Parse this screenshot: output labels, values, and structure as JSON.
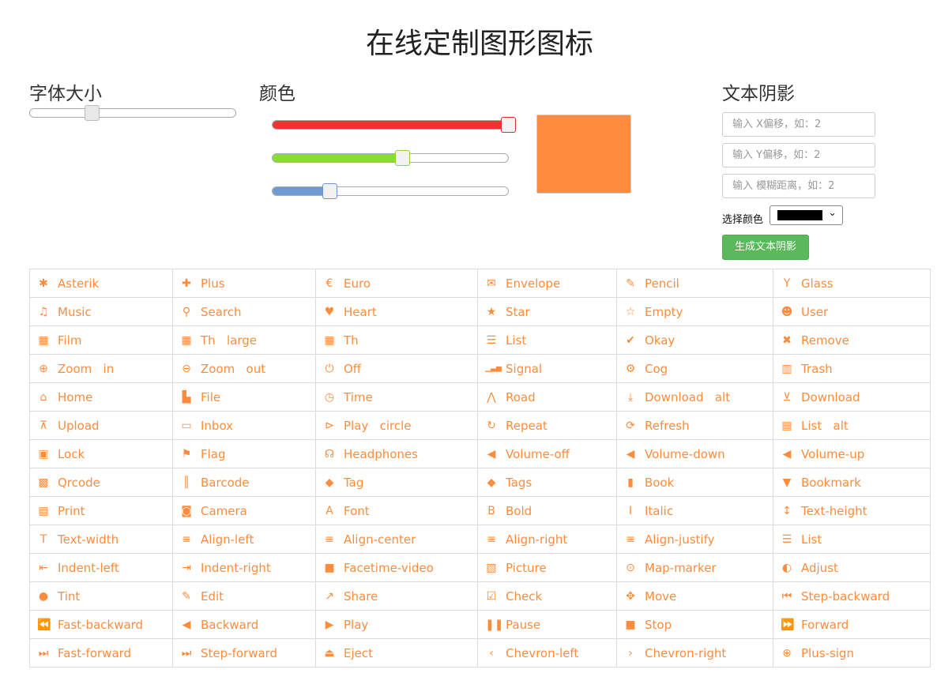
{
  "title": "在线定制图形图标",
  "font_size": {
    "label": "字体大小",
    "value": 0.3
  },
  "color": {
    "label": "颜色",
    "red": 1.0,
    "green": 0.55,
    "blue": 0.24,
    "red_fill": "#ee3333",
    "green_fill": "#88dd33",
    "blue_fill": "#6e9bd1",
    "preview_hex": "#ff8c3d"
  },
  "text_shadow": {
    "label": "文本阴影",
    "x_placeholder": "输入 X偏移，如：2",
    "y_placeholder": "输入 Y偏移，如：2",
    "blur_placeholder": "输入 模糊距离，如：2",
    "color_label": "选择颜色",
    "selected_color": "#000000",
    "button_label": "生成文本阴影",
    "button_color": "#5cb85c"
  },
  "icon_color": "#ff8c3d",
  "icons": [
    [
      {
        "name": "Asterik",
        "icon": "asterisk"
      },
      {
        "name": "Plus",
        "icon": "plus"
      },
      {
        "name": "Euro",
        "icon": "euro"
      },
      {
        "name": "Envelope",
        "icon": "envelope"
      },
      {
        "name": "Pencil",
        "icon": "pencil"
      },
      {
        "name": "Glass",
        "icon": "glass"
      }
    ],
    [
      {
        "name": "Music",
        "icon": "music"
      },
      {
        "name": "Search",
        "icon": "search"
      },
      {
        "name": "Heart",
        "icon": "heart"
      },
      {
        "name": "Star",
        "icon": "star"
      },
      {
        "name": "Empty",
        "icon": "star-empty"
      },
      {
        "name": "User",
        "icon": "user"
      }
    ],
    [
      {
        "name": "Film",
        "icon": "film"
      },
      {
        "name": "Th   large",
        "icon": "th-large"
      },
      {
        "name": "Th",
        "icon": "th"
      },
      {
        "name": "List",
        "icon": "th-list"
      },
      {
        "name": "Okay",
        "icon": "ok"
      },
      {
        "name": "Remove",
        "icon": "remove"
      }
    ],
    [
      {
        "name": "Zoom   in",
        "icon": "zoom-in"
      },
      {
        "name": "Zoom   out",
        "icon": "zoom-out"
      },
      {
        "name": "Off",
        "icon": "off"
      },
      {
        "name": "Signal",
        "icon": "signal"
      },
      {
        "name": "Cog",
        "icon": "cog"
      },
      {
        "name": "Trash",
        "icon": "trash"
      }
    ],
    [
      {
        "name": "Home",
        "icon": "home"
      },
      {
        "name": "File",
        "icon": "file"
      },
      {
        "name": "Time",
        "icon": "time"
      },
      {
        "name": "Road",
        "icon": "road"
      },
      {
        "name": "Download   alt",
        "icon": "download-alt"
      },
      {
        "name": "Download",
        "icon": "download"
      }
    ],
    [
      {
        "name": "Upload",
        "icon": "upload"
      },
      {
        "name": "Inbox",
        "icon": "inbox"
      },
      {
        "name": "Play   circle",
        "icon": "play-circle"
      },
      {
        "name": "Repeat",
        "icon": "repeat"
      },
      {
        "name": "Refresh",
        "icon": "refresh"
      },
      {
        "name": "List   alt",
        "icon": "list-alt"
      }
    ],
    [
      {
        "name": "Lock",
        "icon": "lock"
      },
      {
        "name": "Flag",
        "icon": "flag"
      },
      {
        "name": "Headphones",
        "icon": "headphones"
      },
      {
        "name": "Volume-off",
        "icon": "volume-off"
      },
      {
        "name": "Volume-down",
        "icon": "volume-down"
      },
      {
        "name": "Volume-up",
        "icon": "volume-up"
      }
    ],
    [
      {
        "name": "Qrcode",
        "icon": "qrcode"
      },
      {
        "name": "Barcode",
        "icon": "barcode"
      },
      {
        "name": "Tag",
        "icon": "tag"
      },
      {
        "name": "Tags",
        "icon": "tags"
      },
      {
        "name": "Book",
        "icon": "book"
      },
      {
        "name": "Bookmark",
        "icon": "bookmark"
      }
    ],
    [
      {
        "name": "Print",
        "icon": "print"
      },
      {
        "name": "Camera",
        "icon": "camera"
      },
      {
        "name": "Font",
        "icon": "font"
      },
      {
        "name": "Bold",
        "icon": "bold"
      },
      {
        "name": "Italic",
        "icon": "italic"
      },
      {
        "name": "Text-height",
        "icon": "text-height"
      }
    ],
    [
      {
        "name": "Text-width",
        "icon": "text-width"
      },
      {
        "name": "Align-left",
        "icon": "align-left"
      },
      {
        "name": "Align-center",
        "icon": "align-center"
      },
      {
        "name": "Align-right",
        "icon": "align-right"
      },
      {
        "name": "Align-justify",
        "icon": "align-justify"
      },
      {
        "name": "List",
        "icon": "list"
      }
    ],
    [
      {
        "name": "Indent-left",
        "icon": "indent-left"
      },
      {
        "name": "Indent-right",
        "icon": "indent-right"
      },
      {
        "name": "Facetime-video",
        "icon": "facetime-video"
      },
      {
        "name": "Picture",
        "icon": "picture"
      },
      {
        "name": "Map-marker",
        "icon": "map-marker"
      },
      {
        "name": "Adjust",
        "icon": "adjust"
      }
    ],
    [
      {
        "name": "Tint",
        "icon": "tint"
      },
      {
        "name": "Edit",
        "icon": "edit"
      },
      {
        "name": "Share",
        "icon": "share"
      },
      {
        "name": "Check",
        "icon": "check"
      },
      {
        "name": "Move",
        "icon": "move"
      },
      {
        "name": "Step-backward",
        "icon": "step-backward"
      }
    ],
    [
      {
        "name": "Fast-backward",
        "icon": "fast-backward"
      },
      {
        "name": "Backward",
        "icon": "backward"
      },
      {
        "name": "Play",
        "icon": "play"
      },
      {
        "name": "Pause",
        "icon": "pause"
      },
      {
        "name": "Stop",
        "icon": "stop"
      },
      {
        "name": "Forward",
        "icon": "forward"
      }
    ],
    [
      {
        "name": "Fast-forward",
        "icon": "fast-forward"
      },
      {
        "name": "Step-forward",
        "icon": "step-forward"
      },
      {
        "name": "Eject",
        "icon": "eject"
      },
      {
        "name": "Chevron-left",
        "icon": "chevron-left"
      },
      {
        "name": "Chevron-right",
        "icon": "chevron-right"
      },
      {
        "name": "Plus-sign",
        "icon": "plus-sign"
      }
    ]
  ]
}
